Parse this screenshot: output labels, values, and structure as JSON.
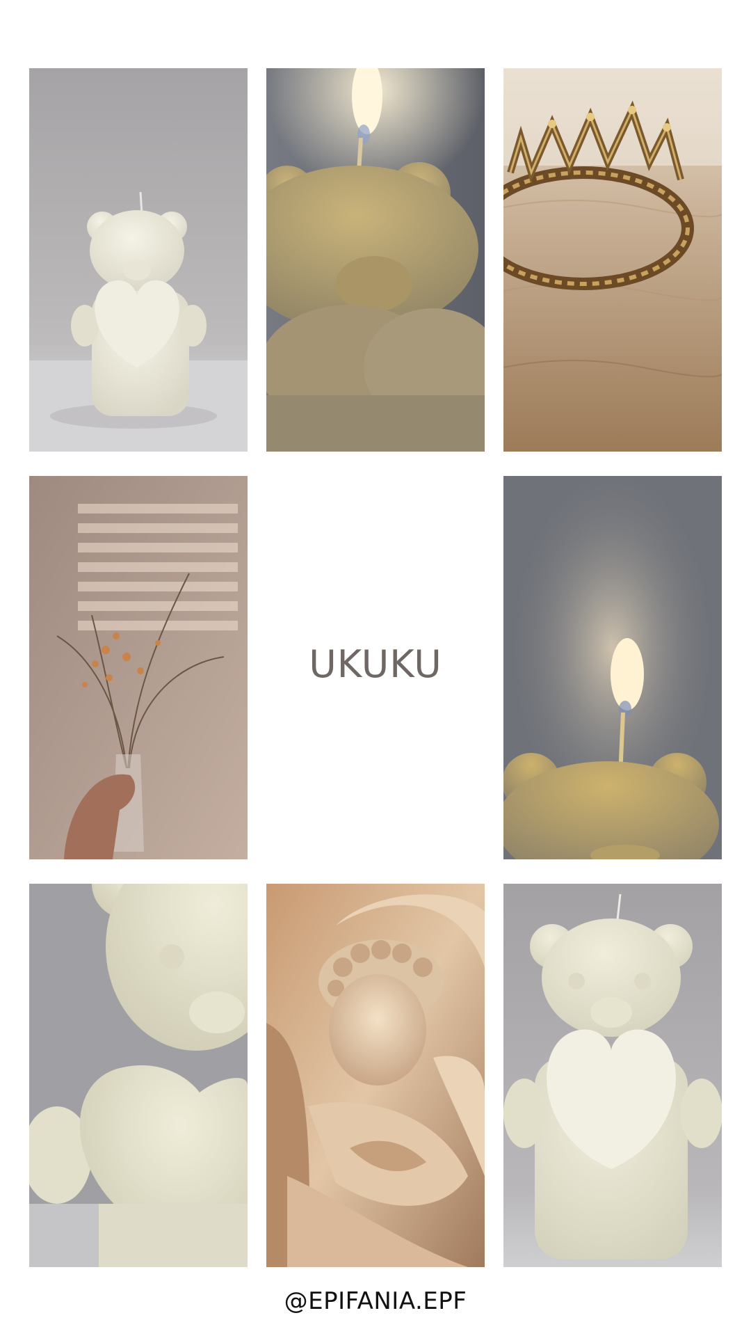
{
  "title": "UKUKU",
  "handle": "@EPIFANIA.EPF",
  "tiles": [
    {
      "icon": "bear-heart-candle-photo"
    },
    {
      "icon": "lit-bear-candle-closeup-photo"
    },
    {
      "icon": "gold-crown-photo"
    },
    {
      "icon": "dried-flowers-vase-photo"
    },
    {
      "icon": "lit-bear-candle-photo"
    },
    {
      "icon": "bear-heart-candle-closeup-photo"
    },
    {
      "icon": "marble-sculpture-photo"
    },
    {
      "icon": "bear-heart-candle-full-photo"
    }
  ],
  "colors": {
    "title": "#6f6764",
    "handle": "#111111",
    "background": "#ffffff"
  }
}
